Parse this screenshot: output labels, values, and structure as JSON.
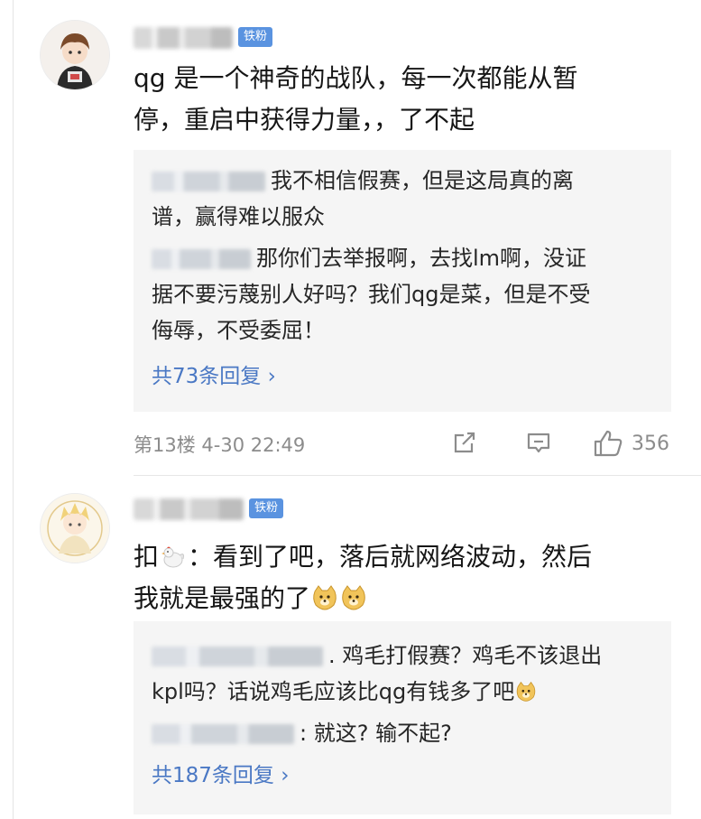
{
  "badge_label": "铁粉",
  "post1": {
    "comment_lines": [
      "qg 是一个神奇的战队，每一次都能从暂",
      "停，重启中获得力量，，了不起"
    ],
    "replies": [
      {
        "lines": [
          "我不相信假赛，但是这局真的离",
          "谱，赢得难以服众"
        ]
      },
      {
        "lines": [
          "那你们去举报啊，去找lm啊，没证",
          "据不要污蔑别人好吗？我们qg是菜，但是不受",
          "侮辱，不受委屈！"
        ]
      }
    ],
    "more_replies": "共73条回复 ›",
    "meta": "第13楼  4-30 22:49",
    "like_count": "356",
    "icons": {
      "share": "share-icon",
      "reply": "comment-icon",
      "like": "thumbs-up-icon"
    }
  },
  "post2": {
    "comment_prefix": "扣",
    "comment_line1_rest": "：看到了吧，落后就网络波动，然后",
    "comment_line2": "我就是最强的了",
    "replies": [
      {
        "line1": ". 鸡毛打假赛？鸡毛不该退出",
        "line2": "kpl吗？话说鸡毛应该比qg有钱多了吧"
      },
      {
        "line1": ": 就这? 输不起?"
      }
    ],
    "more_replies": "共187条回复 ›",
    "icons": {
      "chicken": "chicken-emoji",
      "doge": "doge-emoji"
    }
  },
  "colors": {
    "badge": "#5a93e0",
    "link": "#4a78c4",
    "reply_bg": "#f5f5f5",
    "meta_text": "#8c8c8c"
  }
}
